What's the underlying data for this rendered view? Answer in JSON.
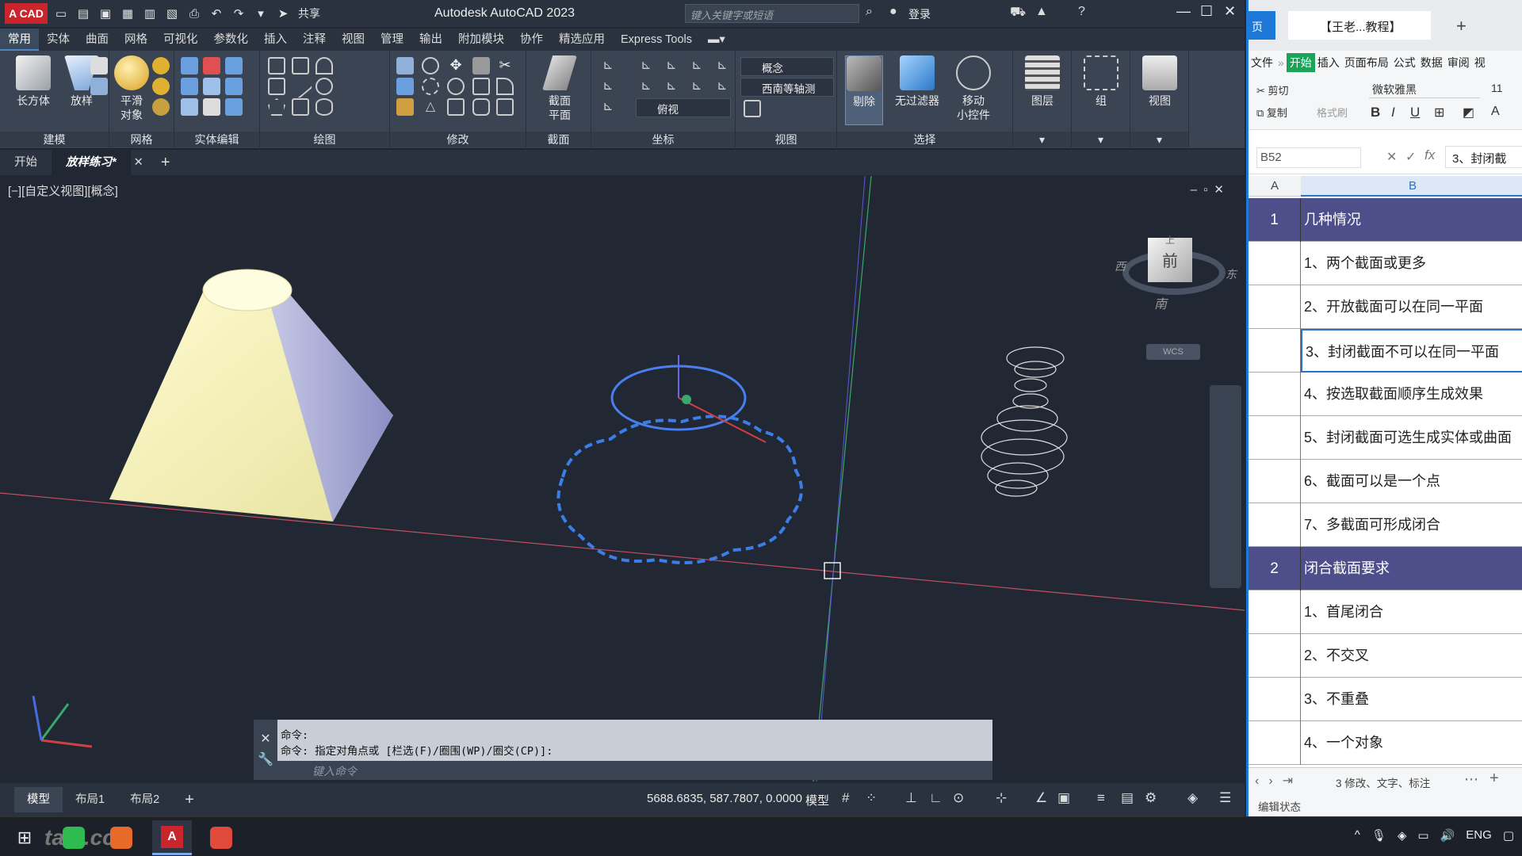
{
  "autocad": {
    "logo_text": "A CAD",
    "share_label": "共享",
    "title": "Autodesk AutoCAD 2023",
    "search_placeholder": "键入关键字或短语",
    "login_label": "登录",
    "menu_tabs": [
      "常用",
      "实体",
      "曲面",
      "网格",
      "可视化",
      "参数化",
      "插入",
      "注释",
      "视图",
      "管理",
      "输出",
      "附加模块",
      "协作",
      "精选应用",
      "Express Tools"
    ],
    "ribbon": {
      "panels": [
        "建模",
        "网格",
        "实体编辑",
        "绘图",
        "修改",
        "截面",
        "坐标",
        "视图",
        "选择"
      ],
      "big_buttons": {
        "box": "长方体",
        "loft": "放样",
        "smooth": "平滑\n对象",
        "section_plane": "截面\n平面",
        "cull": "剔除",
        "no_filter": "无过滤器",
        "move_gizmo": "移动\n小控件",
        "layers": "图层",
        "group": "组",
        "view": "视图"
      },
      "visual_style": "概念",
      "view_direction": "西南等轴测",
      "ucs_view": "俯视"
    },
    "file_tabs": [
      "开始",
      "放样练习*"
    ],
    "viewport_label": "[−][自定义视图][概念]",
    "viewcube": {
      "top": "上",
      "front": "前",
      "west": "西",
      "south": "南",
      "east": "东",
      "wcs": "WCS"
    },
    "command_lines": [
      "命令:",
      "命令: 指定对角点或 [栏选(F)/圈围(WP)/圈交(CP)]:"
    ],
    "command_placeholder": "键入命令",
    "layout_tabs": [
      "模型",
      "布局1",
      "布局2"
    ],
    "coordinates": "5688.6835, 587.7807, 0.0000",
    "model_label": "模型"
  },
  "wps": {
    "tab_home": "页",
    "doc_tab": "【王老...教程】",
    "menu": [
      "文件",
      "开始",
      "插入",
      "页面布局",
      "公式",
      "数据",
      "审阅",
      "视"
    ],
    "cut": "剪切",
    "copy": "复制",
    "format_painter": "格式刷",
    "font": "微软雅黑",
    "font_size": "11",
    "cell_ref": "B52",
    "formula_value": "3、封闭截",
    "col_a": "A",
    "col_b": "B",
    "rows": [
      {
        "a": "1",
        "b": "几种情况",
        "section": true
      },
      {
        "a": "",
        "b": "1、两个截面或更多"
      },
      {
        "a": "",
        "b": "2、开放截面可以在同一平面"
      },
      {
        "a": "",
        "b": "3、封闭截面不可以在同一平面",
        "selected": true
      },
      {
        "a": "",
        "b": "4、按选取截面顺序生成效果"
      },
      {
        "a": "",
        "b": "5、封闭截面可选生成实体或曲面"
      },
      {
        "a": "",
        "b": "6、截面可以是一个点"
      },
      {
        "a": "",
        "b": "7、多截面可形成闭合"
      },
      {
        "a": "2",
        "b": "闭合截面要求",
        "section": true
      },
      {
        "a": "",
        "b": "1、首尾闭合"
      },
      {
        "a": "",
        "b": "2、不交叉"
      },
      {
        "a": "",
        "b": "3、不重叠"
      },
      {
        "a": "",
        "b": "4、一个对象"
      }
    ],
    "sheet_name": "3 修改、文字、标注",
    "status": "编辑状态"
  },
  "taskbar": {
    "watermark": "tafe.cc",
    "lang": "ENG"
  },
  "colors": {
    "acad_bg": "#212733",
    "ribbon": "#3b4453",
    "section_row": "#4d4e8a",
    "wps_accent": "#1e78d7",
    "cad_red": "#c8262c"
  }
}
